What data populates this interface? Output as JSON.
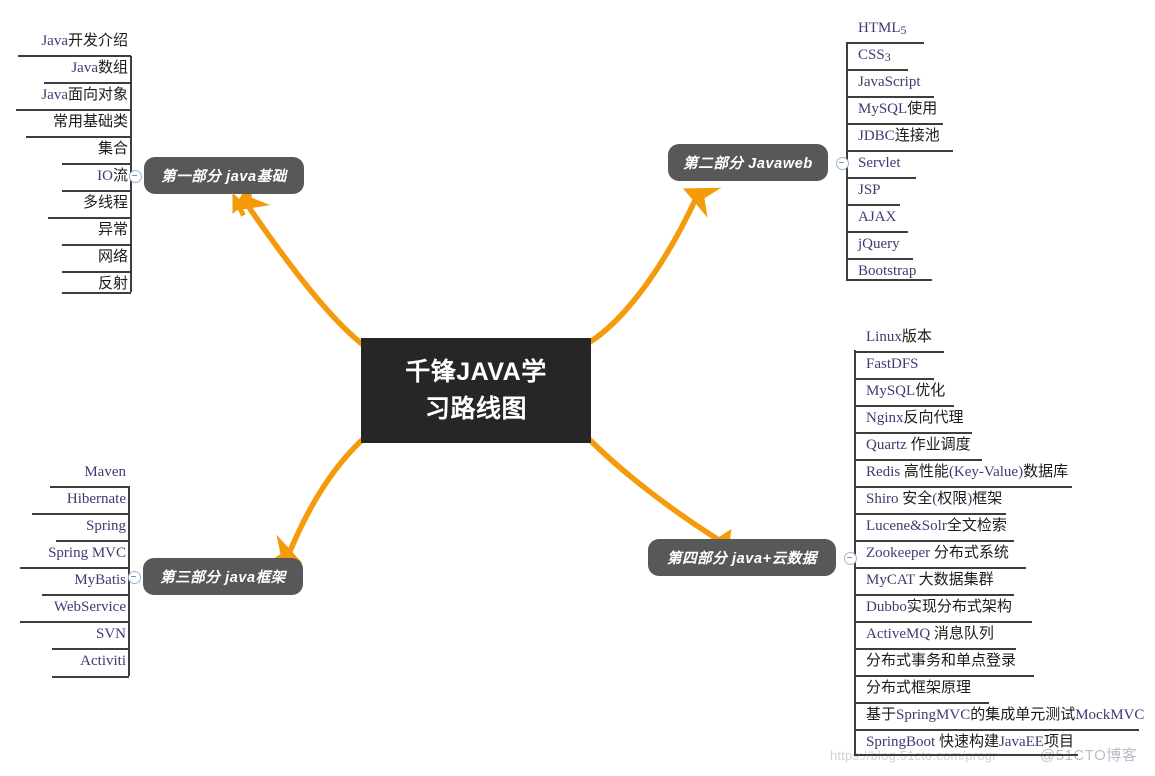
{
  "meta": {
    "background": "#ffffff",
    "accent_orange": "#F59A0B",
    "branch_fill": "#585858",
    "center_fill": "#262626",
    "leaf_latin_color": "#3c3c72",
    "leaf_cjk_color": "#1b1b1b"
  },
  "center": {
    "title_line1": "千锋JAVA学",
    "title_line2": "习路线图",
    "title_full": "千锋JAVA学习路线图"
  },
  "branches": [
    {
      "id": "branch-1",
      "label": "第一部分 java基础",
      "position": "top-left",
      "toggle": "collapse-toggle",
      "items": [
        "Java开发介绍",
        "Java数组",
        "Java面向对象",
        "常用基础类",
        "集合",
        "IO流",
        "多线程",
        "异常",
        "网络",
        "反射"
      ]
    },
    {
      "id": "branch-2",
      "label": "第二部分 Javaweb",
      "position": "top-right",
      "toggle": "collapse-toggle",
      "items": [
        "HTML5",
        "CSS3",
        "JavaScript",
        "MySQL使用",
        "JDBC连接池",
        "Servlet",
        "JSP",
        "AJAX",
        "jQuery",
        "Bootstrap"
      ]
    },
    {
      "id": "branch-3",
      "label": "第三部分 java框架",
      "position": "bottom-left",
      "toggle": "collapse-toggle",
      "items": [
        "Maven",
        "Hibernate",
        "Spring",
        "Spring MVC",
        "MyBatis",
        "WebService",
        "SVN",
        "Activiti"
      ]
    },
    {
      "id": "branch-4",
      "label": "第四部分 java+云数据",
      "position": "bottom-right",
      "toggle": "collapse-toggle",
      "items": [
        "Linux版本",
        "FastDFS",
        "MySQL优化",
        "Nginx反向代理",
        "Quartz 作业调度",
        "Redis 高性能(Key-Value)数据库",
        "Shiro 安全(权限)框架",
        "Lucene&Solr全文检索",
        "Zookeeper 分布式系统",
        "MyCAT 大数据集群",
        "Dubbo实现分布式架构",
        "ActiveMQ 消息队列",
        "分布式事务和单点登录",
        "分布式框架原理",
        "基于SpringMVC的集成单元测试MockMVC",
        "SpringBoot 快速构建JavaEE项目"
      ]
    }
  ],
  "watermark": {
    "text": "@51CTO博客",
    "url_text": "https://blog.51cto.com/progr"
  }
}
